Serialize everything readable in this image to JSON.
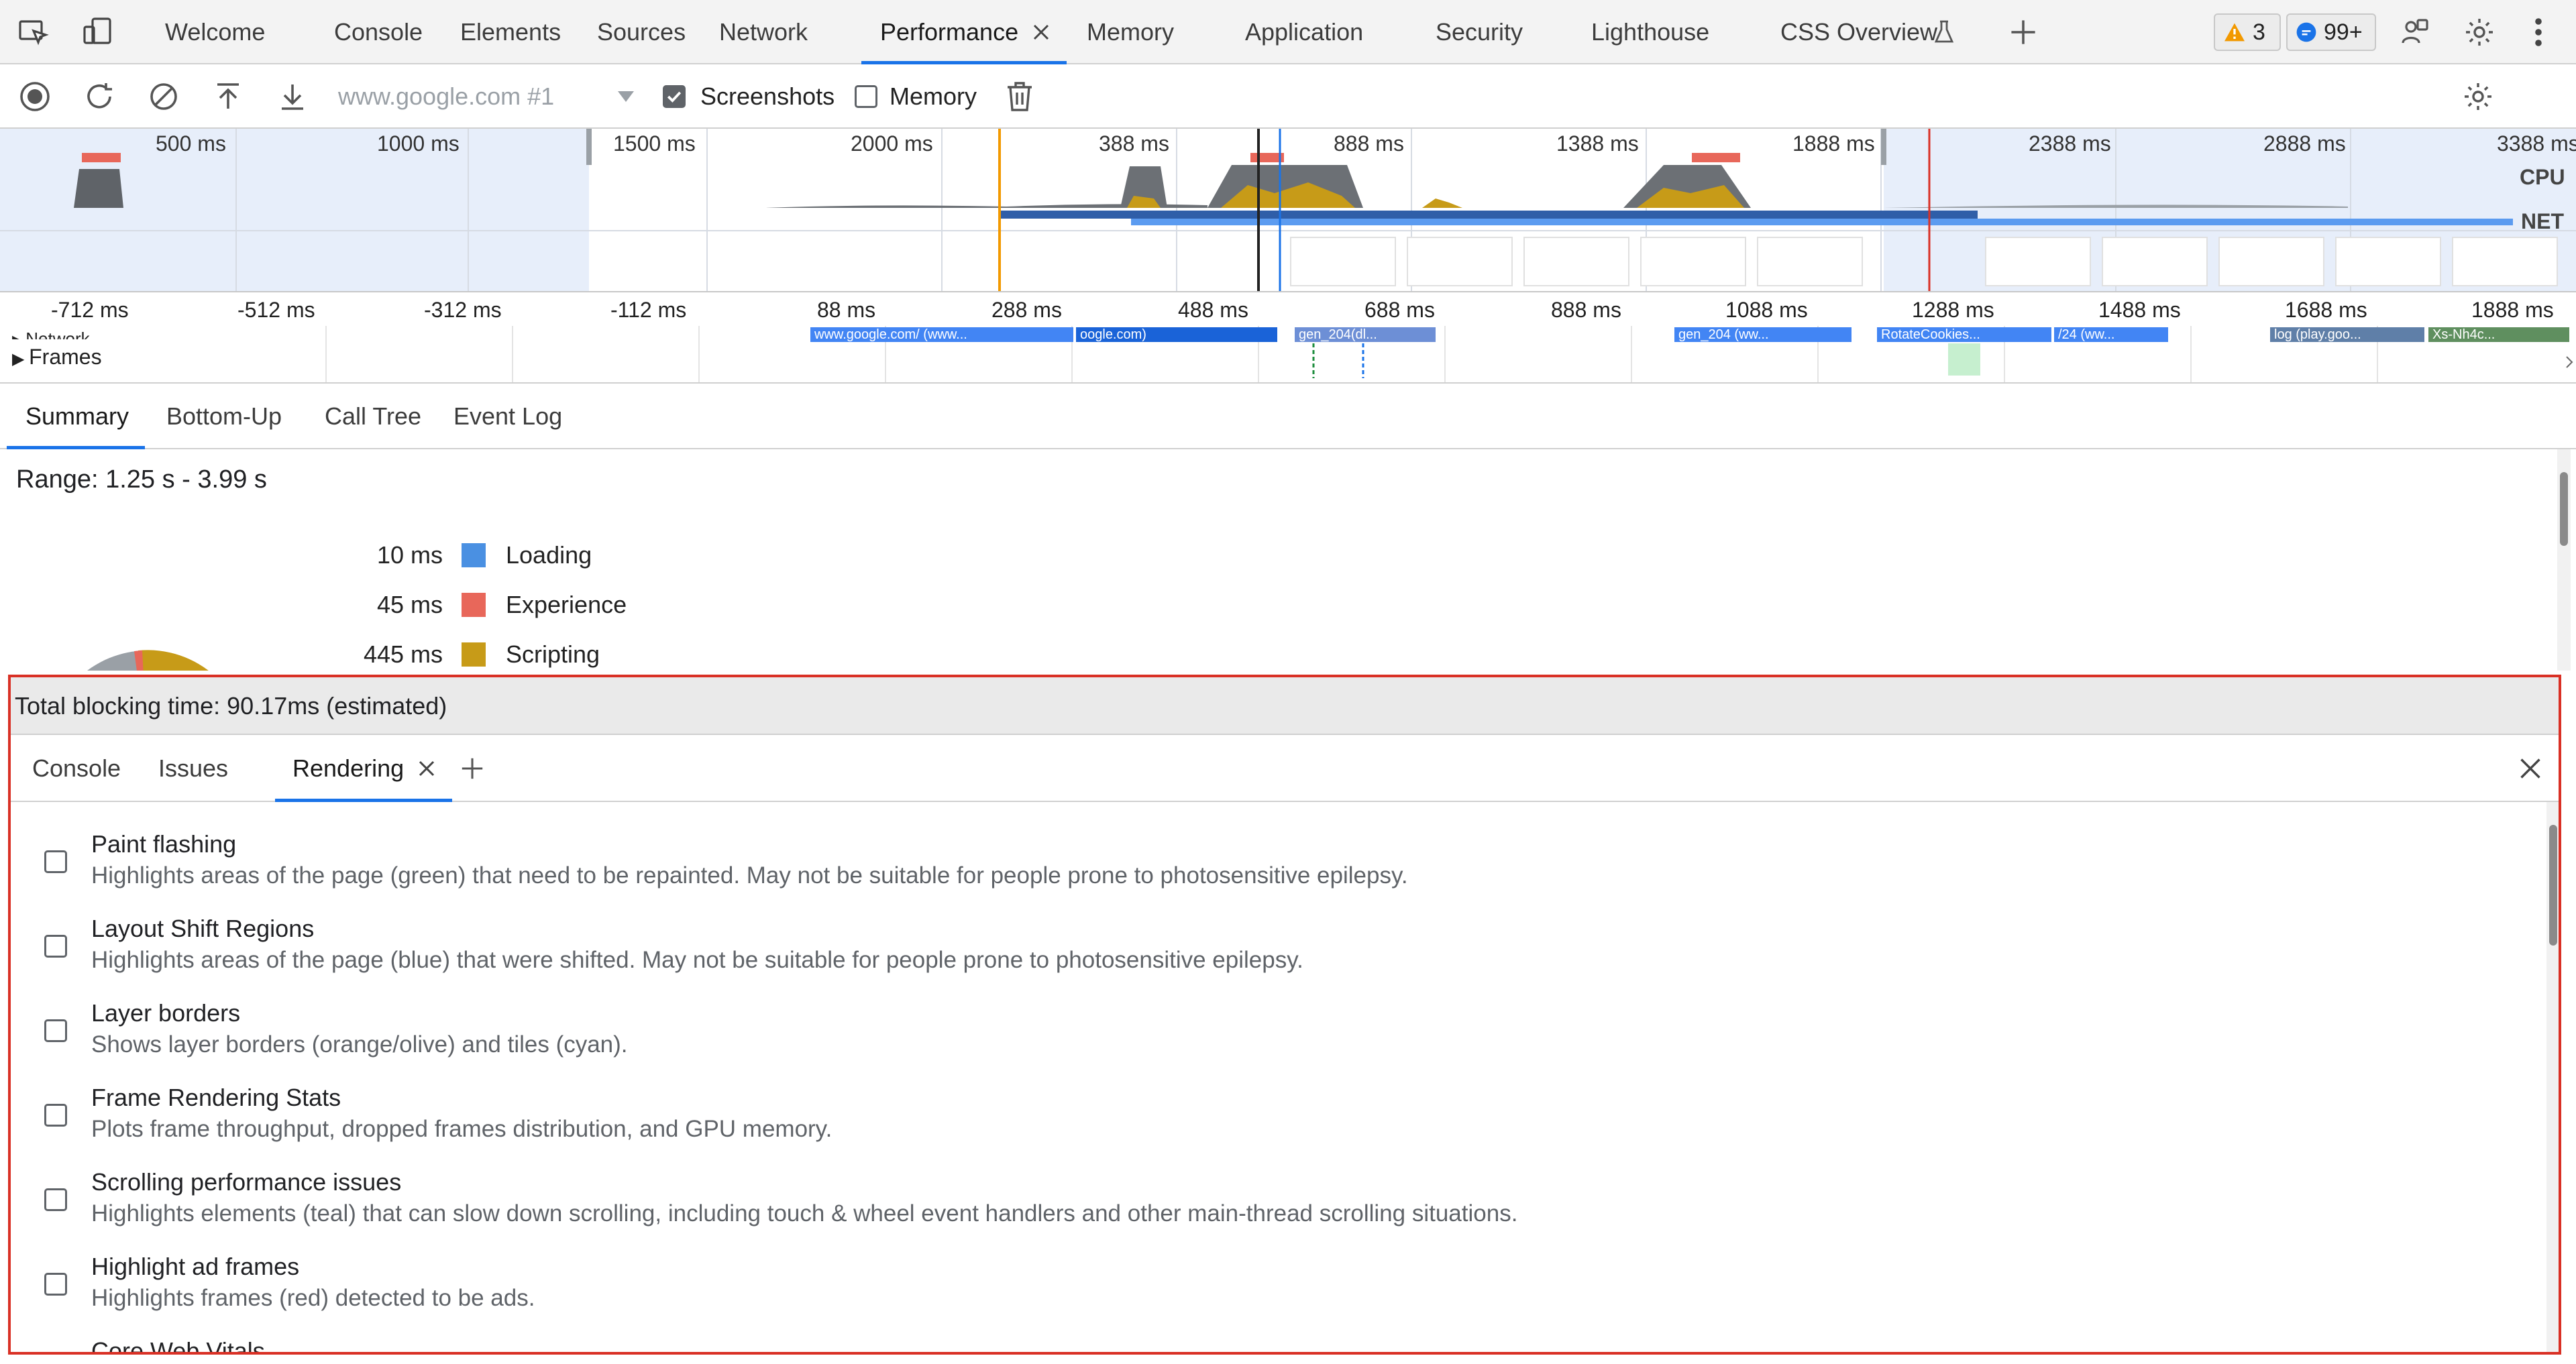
{
  "tabs": [
    {
      "label": "Welcome"
    },
    {
      "label": "Console"
    },
    {
      "label": "Elements"
    },
    {
      "label": "Sources"
    },
    {
      "label": "Network"
    },
    {
      "label": "Performance"
    },
    {
      "label": "Memory"
    },
    {
      "label": "Application"
    },
    {
      "label": "Security"
    },
    {
      "label": "Lighthouse"
    },
    {
      "label": "CSS Overview"
    }
  ],
  "badges": {
    "warnings": "3",
    "messages": "99+"
  },
  "toolbar": {
    "recording_select": "www.google.com #1",
    "screenshots_label": "Screenshots",
    "screenshots_checked": true,
    "memory_label": "Memory",
    "memory_checked": false
  },
  "overview": {
    "ticks": [
      "500 ms",
      "1000 ms",
      "1500 ms",
      "2000 ms",
      "388 ms",
      "888 ms",
      "1388 ms",
      "1888 ms",
      "2388 ms",
      "2888 ms",
      "3388 ms"
    ],
    "cpu_label": "CPU",
    "net_label": "NET"
  },
  "ruler": {
    "ticks": [
      "-712 ms",
      "-512 ms",
      "-312 ms",
      "-112 ms",
      "88 ms",
      "288 ms",
      "488 ms",
      "688 ms",
      "888 ms",
      "1088 ms",
      "1288 ms",
      "1488 ms",
      "1688 ms",
      "1888 ms"
    ],
    "network_label": "Network",
    "frames_label": "Frames",
    "requests": [
      "www.google.com/ (www...",
      "oogle.com)",
      "gen_204(dl...",
      "gen_204 (ww...",
      "RotateCookies...",
      "/24 (ww...",
      "log (play.goo...",
      "Xs-Nh4c..."
    ]
  },
  "summary": {
    "tabs": [
      "Summary",
      "Bottom-Up",
      "Call Tree",
      "Event Log"
    ],
    "range": "Range: 1.25 s - 3.99 s",
    "legend": [
      {
        "time": "10 ms",
        "label": "Loading",
        "color": "#4a90e2"
      },
      {
        "time": "45 ms",
        "label": "Experience",
        "color": "#e8675a"
      },
      {
        "time": "445 ms",
        "label": "Scripting",
        "color": "#c79b18"
      }
    ]
  },
  "status": {
    "total_blocking_time": "Total blocking time: 90.17ms (estimated)"
  },
  "drawer": {
    "tabs": [
      "Console",
      "Issues",
      "Rendering"
    ],
    "options": [
      {
        "title": "Paint flashing",
        "desc": "Highlights areas of the page (green) that need to be repainted. May not be suitable for people prone to photosensitive epilepsy."
      },
      {
        "title": "Layout Shift Regions",
        "desc": "Highlights areas of the page (blue) that were shifted. May not be suitable for people prone to photosensitive epilepsy."
      },
      {
        "title": "Layer borders",
        "desc": "Shows layer borders (orange/olive) and tiles (cyan)."
      },
      {
        "title": "Frame Rendering Stats",
        "desc": "Plots frame throughput, dropped frames distribution, and GPU memory."
      },
      {
        "title": "Scrolling performance issues",
        "desc": "Highlights elements (teal) that can slow down scrolling, including touch & wheel event handlers and other main-thread scrolling situations."
      },
      {
        "title": "Highlight ad frames",
        "desc": "Highlights frames (red) detected to be ads."
      },
      {
        "title": "Core Web Vitals",
        "desc": ""
      }
    ]
  },
  "colors": {
    "accent": "#1a73e8",
    "scripting": "#c79b18",
    "cpu_gray": "#5f6368",
    "frame_outline": "#d93025"
  }
}
